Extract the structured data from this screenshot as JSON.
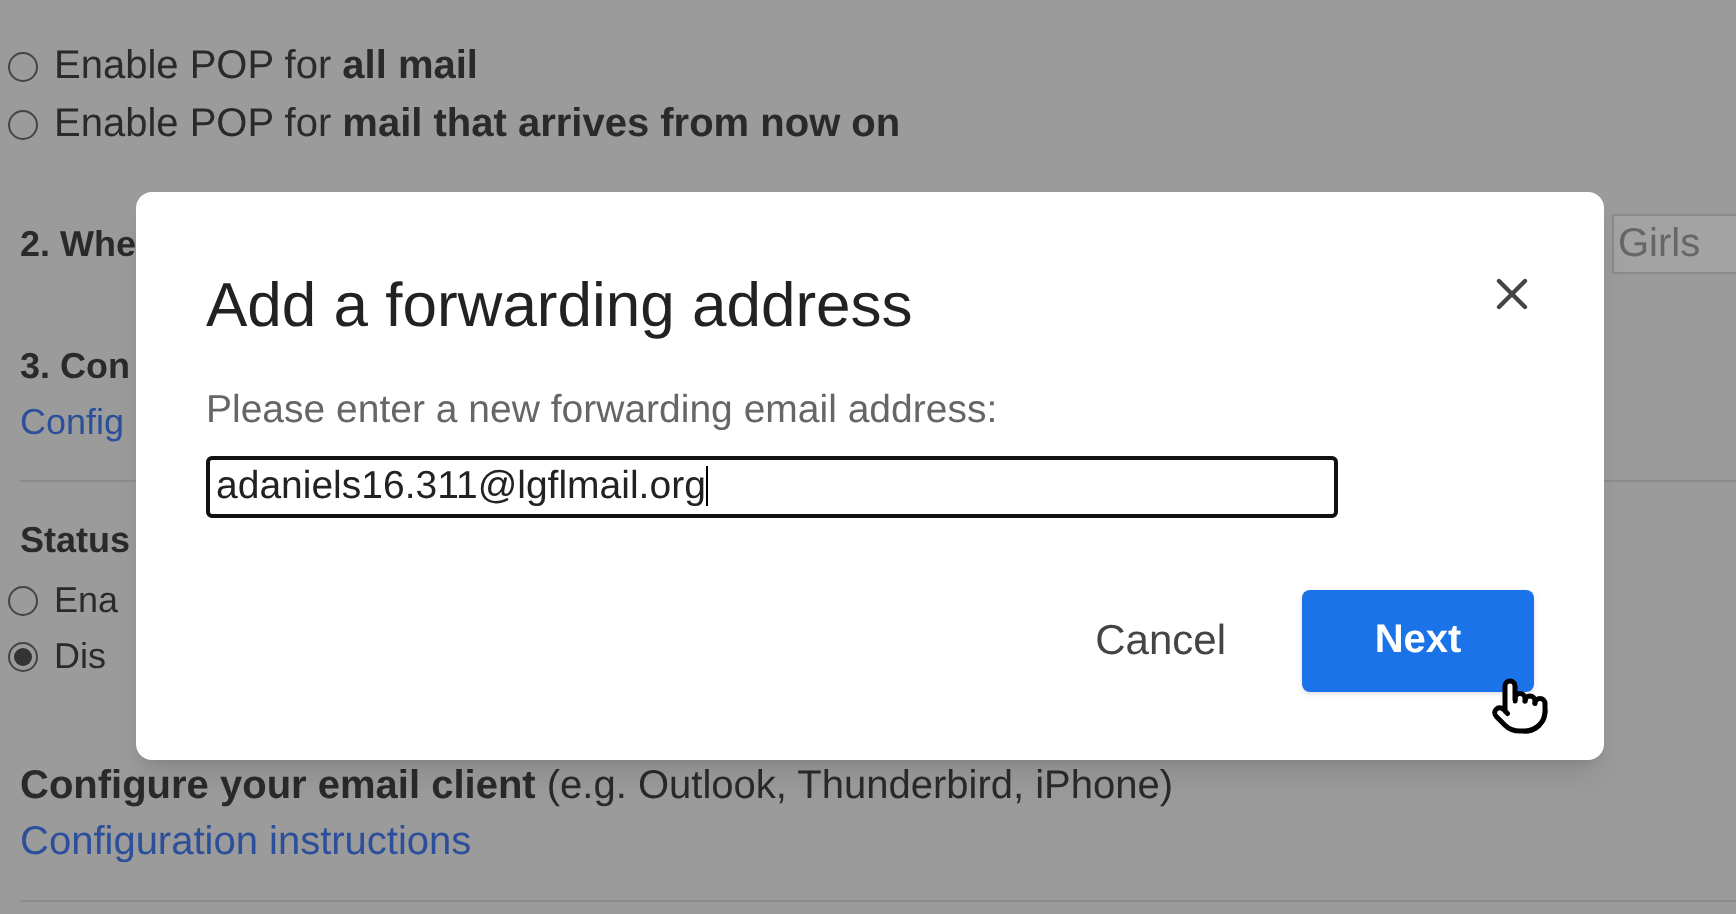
{
  "settings": {
    "pop_options": [
      {
        "label": "Enable POP for **all mail**",
        "selected": false
      },
      {
        "label": "Enable POP for **mail that arrives from now on**",
        "selected": false
      }
    ],
    "section_2_heading": "2. Whe",
    "section_2_field_value": "Girls",
    "section_3_heading": "3. Con",
    "section_3_link": "Config",
    "imap_status_label": "Status",
    "imap_options": [
      {
        "label": "Ena",
        "selected": false
      },
      {
        "label": "Dis",
        "selected": true
      }
    ],
    "client_heading": "**Configure your email client** (e.g. Outlook, Thunderbird, iPhone)",
    "client_link": "Configuration instructions"
  },
  "dialog": {
    "title": "Add a forwarding address",
    "prompt": "Please enter a new forwarding email address:",
    "value": "adaniels16.311@lgflmail.org",
    "buttons": [
      {
        "label": "Cancel",
        "kind": "text"
      },
      {
        "label": "Next",
        "kind": "primary"
      }
    ]
  }
}
